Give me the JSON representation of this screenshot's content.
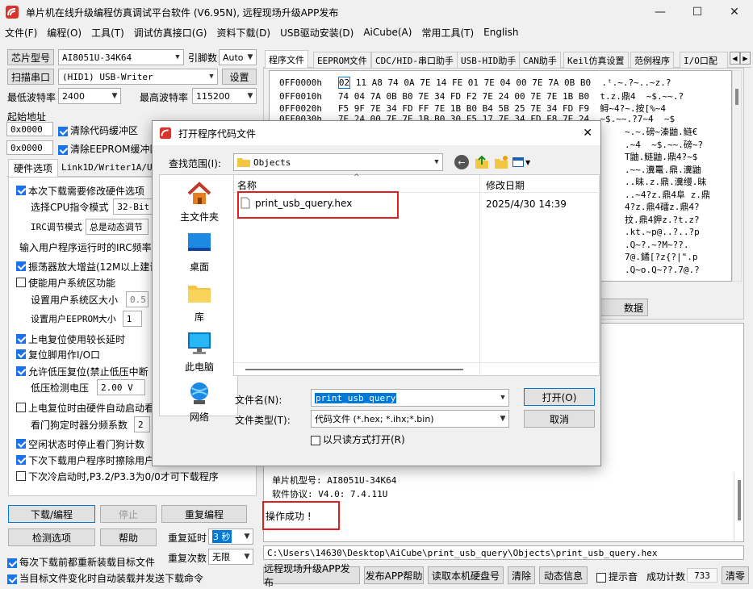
{
  "window": {
    "title": "单片机在线升级编程仿真调试平台软件 (V6.95N), 远程现场升级APP发布",
    "controls": [
      "—",
      "☐",
      "✕"
    ]
  },
  "menu": [
    "文件(F)",
    "编程(O)",
    "工具(T)",
    "调试仿真接口(G)",
    "资料下载(D)",
    "USB驱动安装(D)",
    "AiCube(A)",
    "常用工具(T)",
    "English"
  ],
  "left": {
    "chip_label": "芯片型号",
    "chip_value": "AI8051U-34K64",
    "pin_label": "引脚数",
    "pin_value": "Auto",
    "scan_button": "扫描串口",
    "port_value": "(HID1) USB-Writer",
    "settings_button": "设置",
    "min_baud_label": "最低波特率",
    "min_baud_value": "2400",
    "max_baud_label": "最高波特率",
    "max_baud_value": "115200",
    "start_addr_label": "起始地址",
    "addr1": "0x0000",
    "clear_code": "清除代码缓冲区",
    "addr2": "0x0000",
    "clear_eeprom": "清除EEPROM缓冲区",
    "hw_tab": "硬件选项",
    "link_tab": "Link1D/Writer1A/U8W",
    "options": [
      {
        "label": "本次下载需要修改硬件选项",
        "checked": true
      },
      {
        "label": "选择CPU指令模式",
        "value": "32-Bit"
      },
      {
        "label": "IRC调节模式",
        "value": "总是动态调节"
      },
      {
        "label": "输入用户程序运行时的IRC频率"
      },
      {
        "label": "振荡器放大增益(12M以上建议",
        "checked": true
      },
      {
        "label": "使能用户系统区功能",
        "checked": false
      },
      {
        "label": "设置用户系统区大小",
        "value": "0.5"
      },
      {
        "label": "设置用户EEPROM大小",
        "value": "1"
      },
      {
        "label": "上电复位使用较长延时",
        "checked": true
      },
      {
        "label": "复位脚用作I/O口",
        "checked": true
      },
      {
        "label": "允许低压复位(禁止低压中断",
        "checked": true
      },
      {
        "label": "低压检测电压",
        "value": "2.00 V"
      },
      {
        "label": "上电复位时由硬件自动启动看",
        "checked": false
      },
      {
        "label": "看门狗定时器分频系数",
        "value": "2"
      },
      {
        "label": "空闲状态时停止看门狗计数",
        "checked": true
      },
      {
        "label": "下次下载用户程序时擦除用户",
        "checked": true
      },
      {
        "label": "下次冷启动时,P3.2/P3.3为0/0才可下载程序",
        "checked": false
      }
    ],
    "download_button": "下载/编程",
    "stop_button": "停止",
    "reprogram_button": "重复编程",
    "check_button": "检测选项",
    "help_button": "帮助",
    "repeat_delay_label": "重复延时",
    "repeat_delay_value": "3 秒",
    "repeat_count_label": "重复次数",
    "repeat_count_value": "无限",
    "reload_each": "每次下载前都重新装载目标文件",
    "auto_reload": "当目标文件变化时自动装载并发送下载命令"
  },
  "tabs": [
    "程序文件",
    "EEPROM文件",
    "CDC/HID-串口助手",
    "USB-HID助手",
    "CAN助手",
    "Keil仿真设置",
    "范例程序",
    "I/O口配"
  ],
  "hex": [
    {
      "addr": "0FF0000h",
      "bytes": "02 11 A8 74 0A 7E 14 FE 01 7E 04 00 7E 7A 0B B0",
      "ascii": ".ᵗ.~.?~..~z.?"
    },
    {
      "addr": "0FF0010h",
      "bytes": "74 04 7A 0B B0 7E 34 FD F2 7E 24 00 7E 7E 1B B0",
      "ascii": "t.z.鼎4  ~$.~~.?"
    },
    {
      "addr": "0FF0020h",
      "bytes": "F5 9F 7E 34 FD FF 7E 1B B0 B4 5B 25 7E 34 FD F9",
      "ascii": "鲟~4?~.按[%~4"
    },
    {
      "addr": "0FF0030h",
      "bytes": "7E 24 00 7E 7E 1B B0 30 F5 17 7E 34 FD F8 7E 24",
      "ascii": "~$.~~.?7~4  ~$"
    }
  ],
  "hex_ascii_more": [
    "~.~.磅~溱鼬.鲢€",
    ".~4  ~$.~~.磅~?",
    "T鼬.鲢鼬.鼎4?~$",
    ".~~.瀵鼍.鼎.瀵鼬",
    "..昧.z.鼎.瀵缦.昧",
    "..~4?z.鼎4阜 z.鼎",
    "4?z.鼎4礌z.鼎4?",
    "抆.鼎4鉀z.?t.z?",
    ".kt.~p@..?..?p",
    ".Q~?.~?M~??.",
    "7@.鐍[?z{?|\".p",
    ".Q~o.Q~??.7@.?"
  ],
  "hex_addr_button": "数据",
  "dialog": {
    "title": "打开程序代码文件",
    "close": "✕",
    "look_in_label": "查找范围(I):",
    "look_in_value": "Objects",
    "places": [
      "主文件夹",
      "桌面",
      "库",
      "此电脑",
      "网络"
    ],
    "col_name": "名称",
    "col_date": "修改日期",
    "files": [
      {
        "name": "print_usb_query.hex",
        "date": "2025/4/30 14:39"
      }
    ],
    "filename_label": "文件名(N):",
    "filename_value": "print_usb_query",
    "filetype_label": "文件类型(T):",
    "filetype_value": "代码文件 (*.hex;  *.ihx;*.bin)",
    "readonly_label": "以只读方式打开(R)",
    "open_button": "打开(O)",
    "cancel_button": "取消"
  },
  "log": {
    "chip_line": "单片机型号: AI8051U-34K64",
    "protocol_line": "软件协议: V4.0: 7.4.11U",
    "success": "操作成功 !"
  },
  "path": "C:\\Users\\14630\\Desktop\\AiCube\\print_usb_query\\Objects\\print_usb_query.hex",
  "bottom": {
    "publish": "远程现场升级APP发布",
    "publish_help": "发布APP帮助",
    "read_disk": "读取本机硬盘号",
    "clear": "清除",
    "dynamic": "动态信息",
    "sound": "提示音",
    "count_label": "成功计数",
    "count_value": "733",
    "reset": "清零"
  }
}
